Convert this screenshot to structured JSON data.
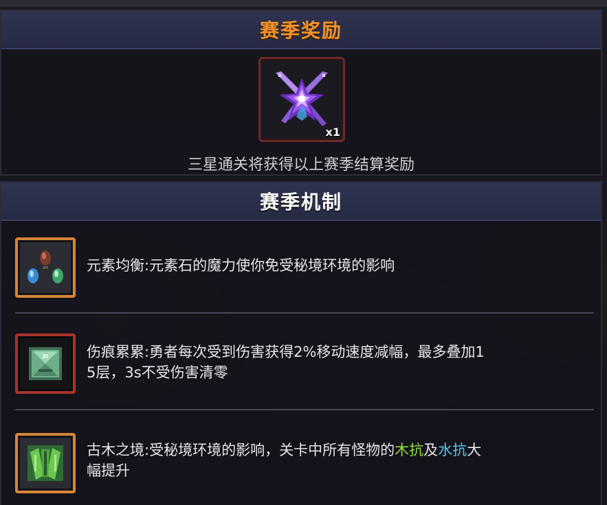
{
  "season_rewards": {
    "title": "赛季奖励",
    "reward_item": {
      "icon": "purple-crystal-star-shuriken-icon",
      "quantity": "x1"
    },
    "note": "三星通关将获得以上赛季结算奖励"
  },
  "season_mechanics": {
    "title": "赛季机制",
    "items": [
      {
        "icon": "elemental-stones-icon",
        "text": "元素均衡:元素石的魔力使你免受秘境环境的影响"
      },
      {
        "icon": "wound-stack-icon",
        "text_line1": "伤痕累累:勇者每次受到伤害获得2%移动速度减幅，最多叠加1",
        "text_line2": "5层，3s不受伤害清零"
      },
      {
        "icon": "ancient-wood-leaf-icon",
        "text_prefix": "古木之境:受秘境环境的影响，关卡中所有怪物的",
        "wood_resist": "木抗",
        "conjunction": "及",
        "water_resist": "水抗",
        "text_suffix_line1": "大",
        "text_line2": "幅提升"
      }
    ]
  },
  "colors": {
    "rewards_title": "#f2932a",
    "wood_highlight": "#8fdb3c",
    "water_highlight": "#56c8ea",
    "slot_border": "#6b2a2a",
    "icon_border_orange": "#d88638",
    "icon_border_red": "#a8332a"
  }
}
